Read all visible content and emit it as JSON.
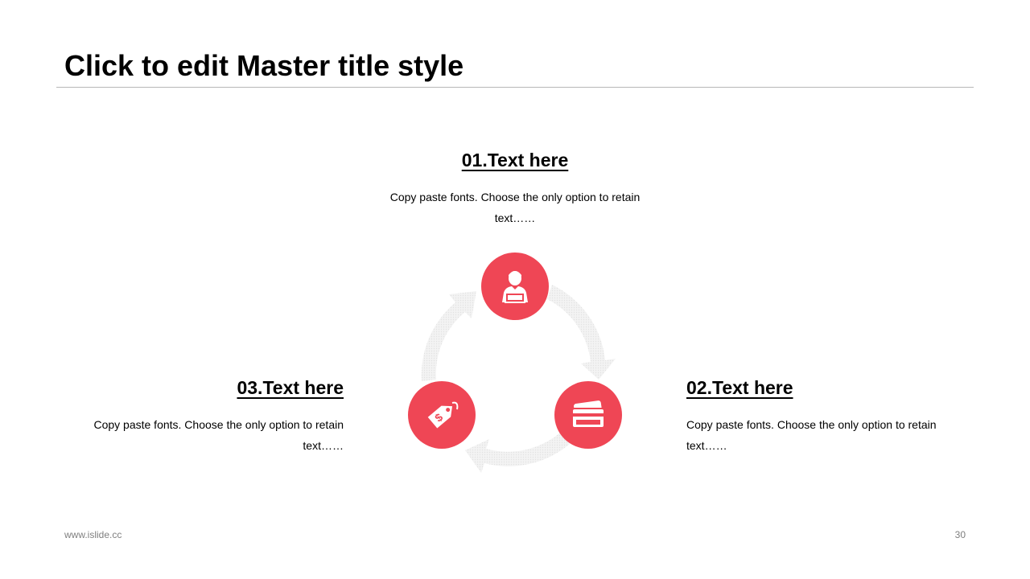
{
  "slide": {
    "title": "Click to edit Master title style",
    "items": [
      {
        "heading": "01.Text here",
        "body": "Copy paste fonts. Choose the only option to retain text……",
        "icon": "person-laptop-icon"
      },
      {
        "heading": "02.Text here",
        "body": "Copy paste fonts. Choose the only option to retain text……",
        "icon": "credit-card-icon"
      },
      {
        "heading": "03.Text here",
        "body": "Copy paste fonts. Choose the only option to retain text……",
        "icon": "price-tag-icon"
      }
    ],
    "footer": {
      "website": "www.islide.cc",
      "page_number": "30"
    }
  },
  "colors": {
    "accent": "#ef4655",
    "arrow": "#eeeeee",
    "rule": "#b7b7b7",
    "footer_text": "#7f7f7f"
  }
}
